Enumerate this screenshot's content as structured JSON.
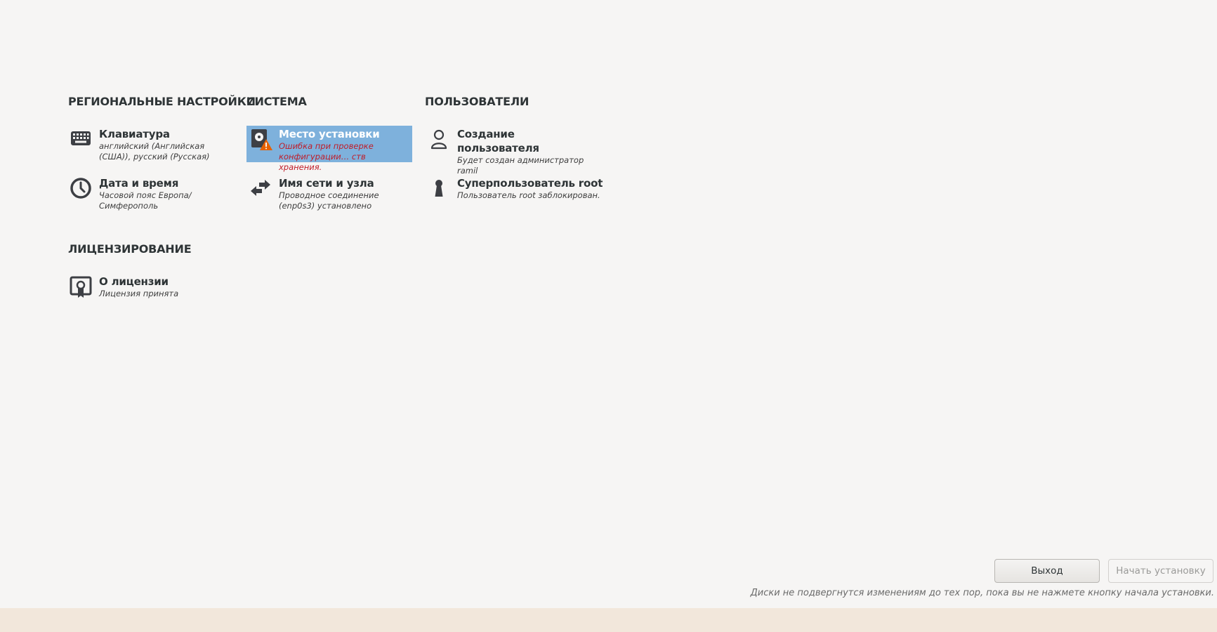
{
  "sections": {
    "regional": "РЕГИОНАЛЬНЫЕ НАСТРОЙКИ",
    "system": "СИСТЕМА",
    "users": "ПОЛЬЗОВАТЕЛИ",
    "licensing": "ЛИЦЕНЗИРОВАНИЕ"
  },
  "spokes": {
    "keyboard": {
      "icon": "keyboard-icon",
      "title": "Клавиатура",
      "status": "английский (Английская\n(США)), русский (Русская)"
    },
    "datetime": {
      "icon": "clock-icon",
      "title": "Дата и время",
      "status": "Часовой пояс Европа/\nСимферополь"
    },
    "storage": {
      "icon": "disk-warning-icon",
      "title": "Место установки",
      "status": "Ошибка при проверке\nконфигурации… ств хранения.",
      "status_color": "#c01c28",
      "selected": true
    },
    "network": {
      "icon": "network-arrows-icon",
      "title": "Имя сети и узла",
      "status": "Проводное соединение\n(enp0s3) установлено"
    },
    "user": {
      "icon": "user-icon",
      "title": "Создание пользователя",
      "status": "Будет создан администратор\nramil"
    },
    "root": {
      "icon": "keyhole-icon",
      "title": "Суперпользователь root",
      "status": "Пользователь root заблокирован."
    },
    "license": {
      "icon": "license-certificate-icon",
      "title": "О лицензии",
      "status": "Лицензия принята"
    }
  },
  "buttons": {
    "quit": "Выход",
    "begin": "Начать установку",
    "begin_enabled": false
  },
  "footer_note": "Диски не подвергнутся изменениям до тех пор, пока вы не нажмете кнопку начала установки.",
  "colors": {
    "background": "#f6f5f4",
    "selected": "#7eb1dc",
    "error": "#c01c28",
    "bottom_bar": "#f2e7db"
  }
}
